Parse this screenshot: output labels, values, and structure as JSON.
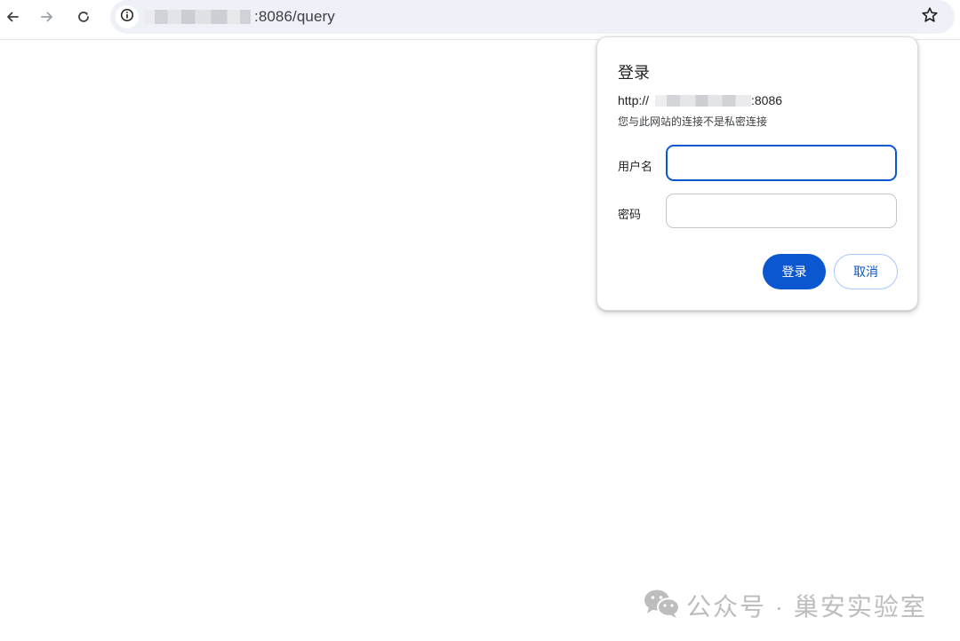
{
  "browser": {
    "url_suffix": ":8086/query",
    "icons": {
      "back": "arrow-left-icon",
      "forward": "arrow-right-icon",
      "reload": "reload-icon",
      "site_info": "info-icon",
      "bookmark": "star-icon"
    }
  },
  "dialog": {
    "title": "登录",
    "origin_prefix": "http://",
    "origin_suffix": ":8086",
    "warning": "您与此网站的连接不是私密连接",
    "username_label": "用户名",
    "password_label": "密码",
    "username_value": "",
    "password_value": "",
    "login_button": "登录",
    "cancel_button": "取消"
  },
  "watermark": {
    "text": "公众号 · 巢安实验室",
    "icon": "wechat-icon"
  },
  "colors": {
    "accent": "#0b57d0",
    "omnibox_bg": "#eef1f8",
    "cancel_border": "#a8c7fa",
    "watermark_text": "#bdbdbd"
  }
}
